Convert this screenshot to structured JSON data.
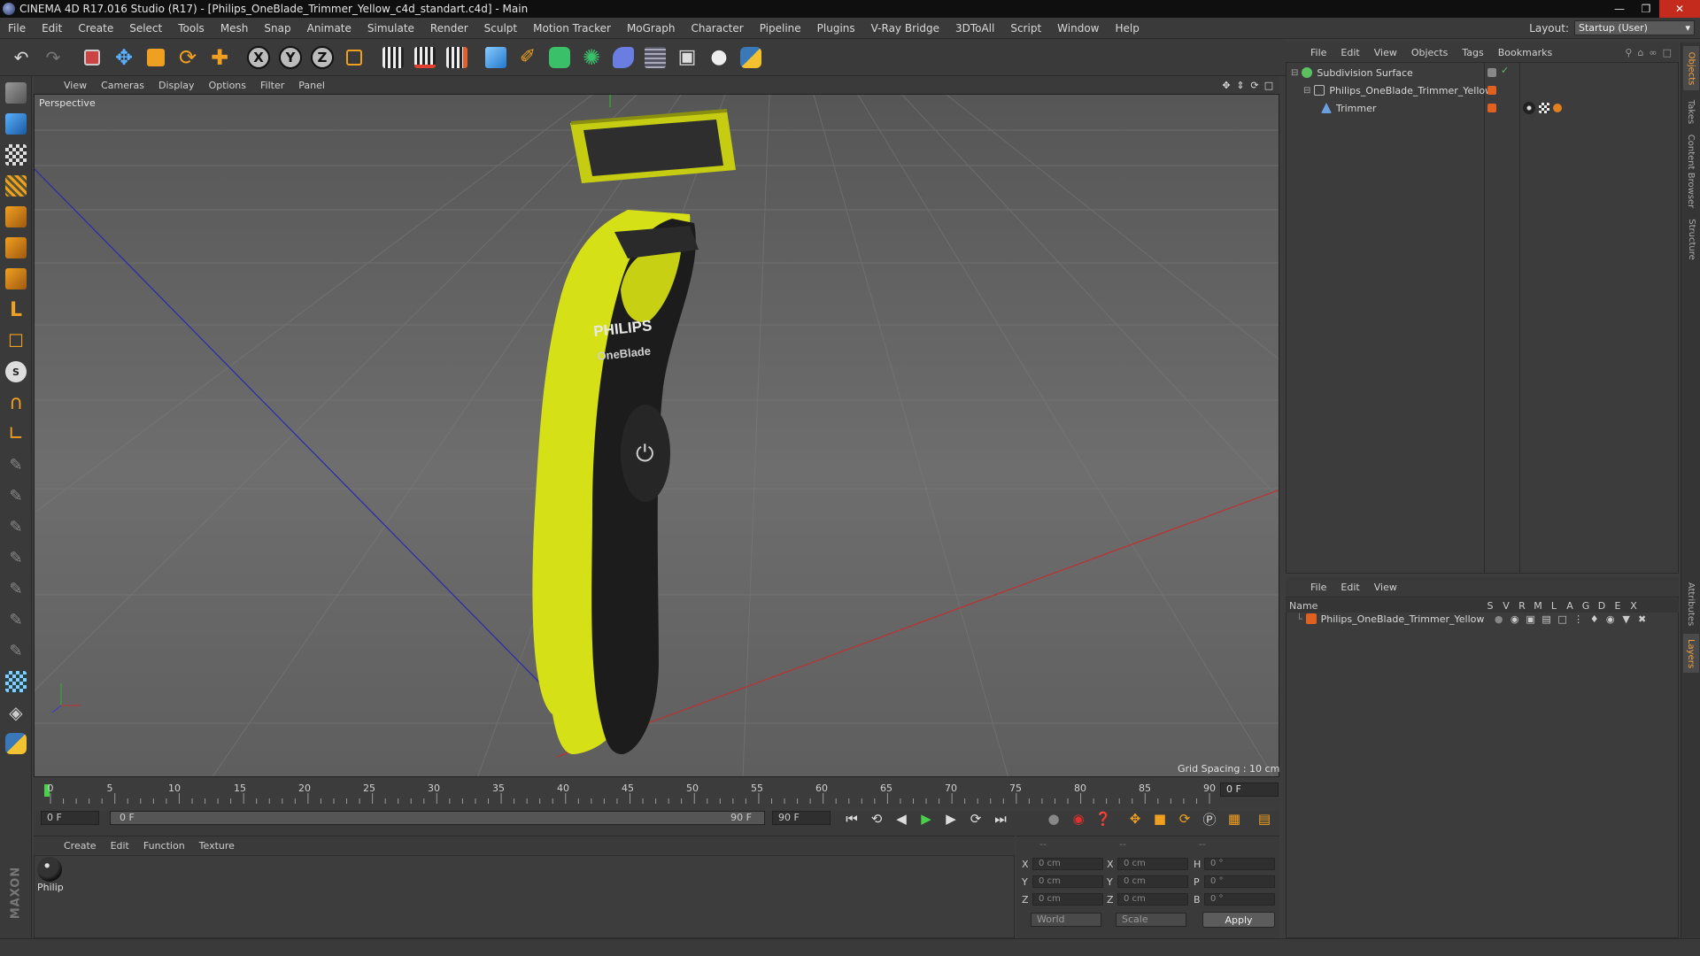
{
  "window": {
    "title": "CINEMA 4D R17.016 Studio (R17) - [Philips_OneBlade_Trimmer_Yellow_c4d_standart.c4d] - Main"
  },
  "menubar": {
    "items": [
      "File",
      "Edit",
      "Create",
      "Select",
      "Tools",
      "Mesh",
      "Snap",
      "Animate",
      "Simulate",
      "Render",
      "Sculpt",
      "Motion Tracker",
      "MoGraph",
      "Character",
      "Pipeline",
      "Plugins",
      "V-Ray Bridge",
      "3DToAll",
      "Script",
      "Window",
      "Help"
    ],
    "layout_label": "Layout:",
    "layout_value": "Startup (User)"
  },
  "viewport": {
    "menus": [
      "View",
      "Cameras",
      "Display",
      "Options",
      "Filter",
      "Panel"
    ],
    "label": "Perspective",
    "grid_spacing": "Grid Spacing : 10 cm",
    "colors": {
      "x_axis": "#c03030",
      "z_axis": "#2a2aa8",
      "trimmer_yellow": "#d6e016",
      "trimmer_black": "#1a1a1a"
    },
    "brand_text": "PHILIPS",
    "model_text": "OneBlade"
  },
  "timeline": {
    "ticks": [
      "0",
      "5",
      "10",
      "15",
      "20",
      "25",
      "30",
      "35",
      "40",
      "45",
      "50",
      "55",
      "60",
      "65",
      "70",
      "75",
      "80",
      "85",
      "90"
    ],
    "current_frame": "0 F"
  },
  "playback": {
    "start_field": "0 F",
    "range_start": "0 F",
    "range_end": "90 F",
    "end_field": "90 F"
  },
  "materials": {
    "menus": [
      "Create",
      "Edit",
      "Function",
      "Texture"
    ],
    "items": [
      {
        "label": "Philip"
      }
    ]
  },
  "coordinates": {
    "headers": [
      "--",
      "--",
      "--"
    ],
    "rows": [
      {
        "a": "X",
        "av": "0 cm",
        "b": "X",
        "bv": "0 cm",
        "c": "H",
        "cv": "0 °"
      },
      {
        "a": "Y",
        "av": "0 cm",
        "b": "Y",
        "bv": "0 cm",
        "c": "P",
        "cv": "0 °"
      },
      {
        "a": "Z",
        "av": "0 cm",
        "b": "Z",
        "bv": "0 cm",
        "c": "B",
        "cv": "0 °"
      }
    ],
    "space": "World",
    "mode": "Scale",
    "apply": "Apply"
  },
  "object_manager": {
    "menus": [
      "File",
      "Edit",
      "View",
      "Objects",
      "Tags",
      "Bookmarks"
    ],
    "objects": [
      {
        "name": "Subdivision Surface",
        "color": "#5cc060"
      },
      {
        "name": "Philips_OneBlade_Trimmer_Yellow",
        "color": "#9a9a9a"
      },
      {
        "name": "Trimmer",
        "color": "#6aa0e0"
      }
    ]
  },
  "layer_manager": {
    "menus": [
      "File",
      "Edit",
      "View"
    ],
    "header_name": "Name",
    "columns": [
      "S",
      "V",
      "R",
      "M",
      "L",
      "A",
      "G",
      "D",
      "E",
      "X"
    ],
    "layers": [
      {
        "name": "Philips_OneBlade_Trimmer_Yellow",
        "color": "#e06020"
      }
    ]
  },
  "side_tabs": [
    "Objects",
    "Takes",
    "Content Browser",
    "Structure",
    "Attributes",
    "Layers"
  ]
}
